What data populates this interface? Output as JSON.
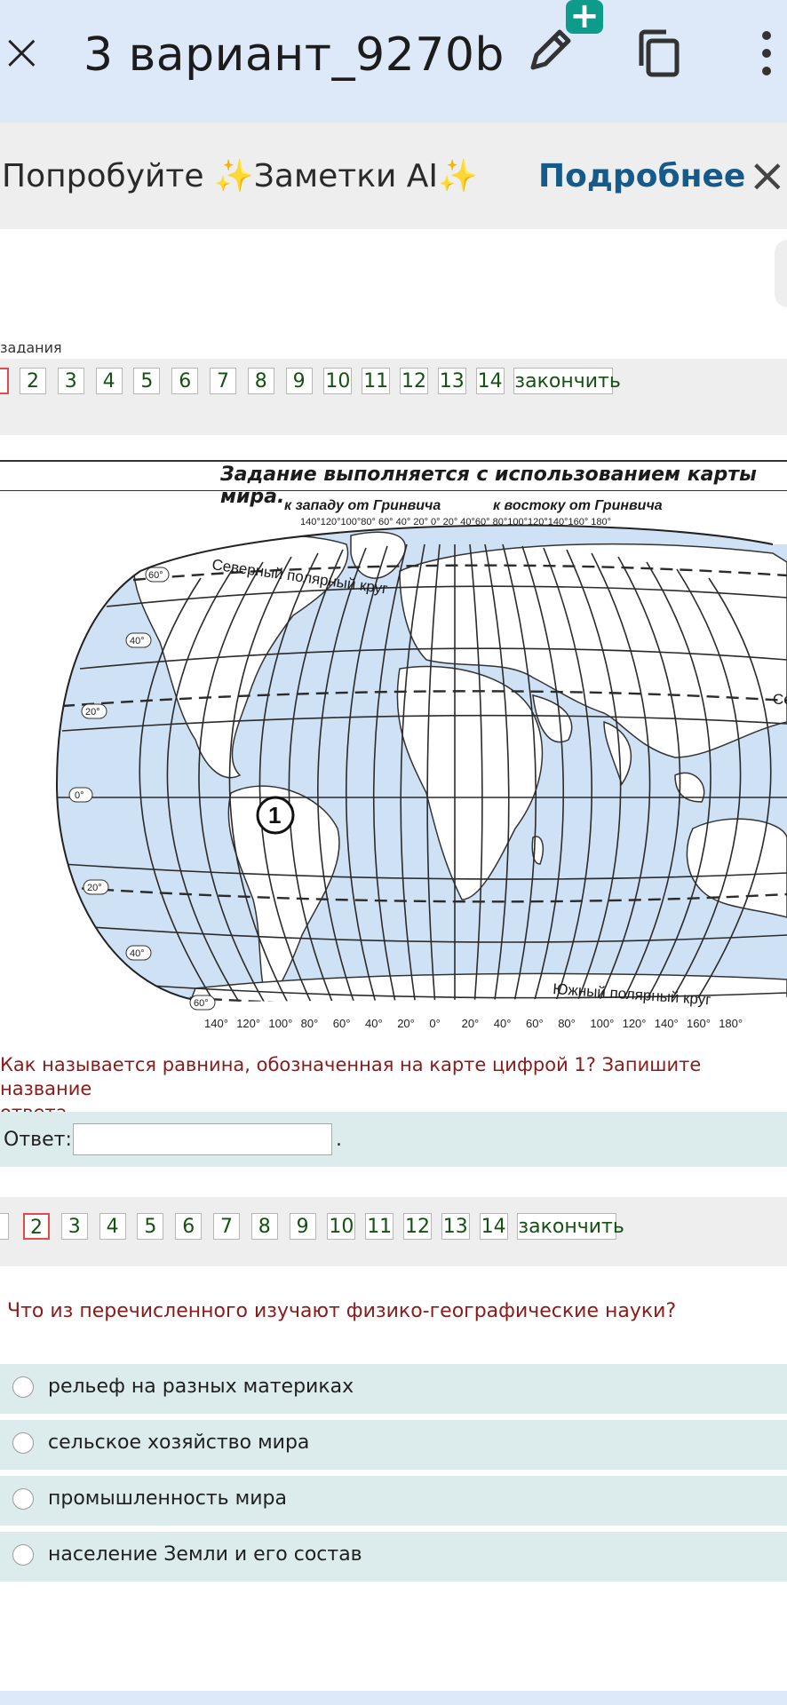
{
  "app_bar": {
    "title": "3 вариант_9270b",
    "icons": [
      "close-icon",
      "edit-pen-icon",
      "plus-icon",
      "copy-icon",
      "more-vertical-icon"
    ]
  },
  "promo": {
    "text": "Попробуйте ✨Заметки AI✨",
    "link": "Подробнее"
  },
  "top_cut_text": "задания",
  "pager_top": {
    "items": [
      "2",
      "3",
      "4",
      "5",
      "6",
      "7",
      "8",
      "9",
      "10",
      "11",
      "12",
      "13",
      "14"
    ],
    "finish": "закончить"
  },
  "map": {
    "caption": "Задание выполняется с использованием карты мира.",
    "west_label": "к западу от Гринвича",
    "east_label": "к востоку от Гринвича",
    "top_scale": "140°120°100°80° 60° 40° 20°  0° 20° 40°60° 80°100°120°140°160° 180°",
    "bottom_ticks": [
      "140°",
      "120°",
      "100°",
      "80°",
      "60°",
      "40°",
      "20°",
      "0°",
      "20°",
      "40°",
      "60°",
      "80°",
      "100°",
      "120°",
      "140°",
      "160°",
      "180°"
    ],
    "lat_labels": [
      "60°",
      "40°",
      "20°",
      "0°",
      "20°",
      "40°",
      "60°"
    ],
    "north_circle": "Северный полярный круг",
    "south_circle": "Южный полярный круг",
    "right_cut": "Се",
    "marker": "1"
  },
  "question1": {
    "text": "Как называется равнина, обозначенная на карте цифрой 1? Запишите название ответа.",
    "line1": "Как называется равнина, обозначенная на карте цифрой 1? Запишите название",
    "line2": "ответа.",
    "answer_label": "Ответ:",
    "answer_value": "",
    "answer_suffix": "."
  },
  "pager_bottom": {
    "items": [
      "2",
      "3",
      "4",
      "5",
      "6",
      "7",
      "8",
      "9",
      "10",
      "11",
      "12",
      "13",
      "14"
    ],
    "finish": "закончить",
    "active": "2"
  },
  "question2": {
    "text": "Что из перечисленного изучают физико-географические науки?",
    "options": [
      "рельеф на разных материках",
      "сельское хозяйство мира",
      "промышленность мира",
      "население Земли и его состав"
    ]
  }
}
